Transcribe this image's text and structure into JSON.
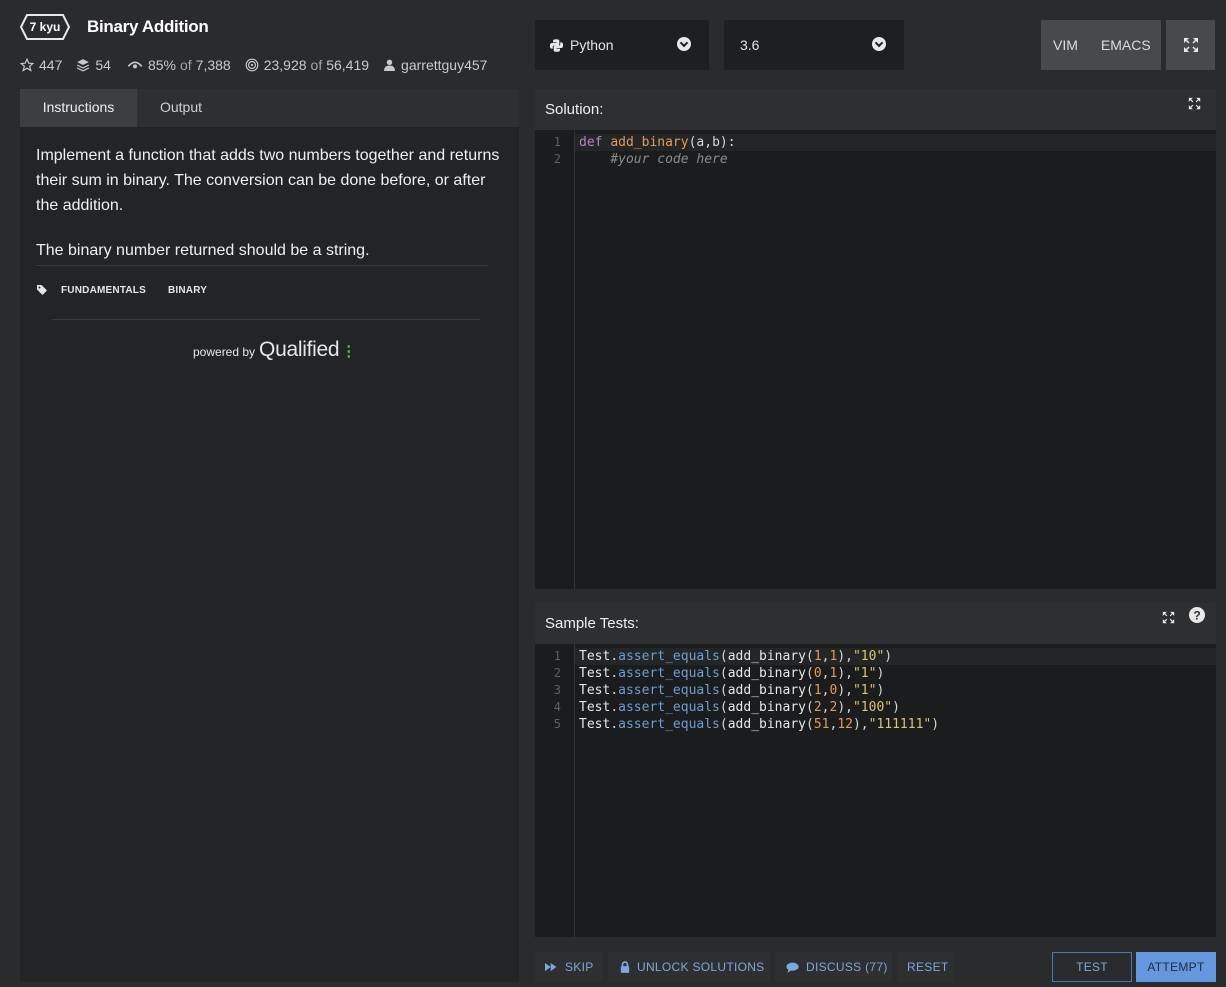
{
  "kata": {
    "rank": "7 kyu",
    "title": "Binary Addition",
    "stars": "447",
    "collections": "54",
    "satisfaction": "85%",
    "satisfaction_of": "of",
    "votes": "7,388",
    "completed": "23,928",
    "completed_of": "of",
    "attempts": "56,419",
    "author": "garrettguy457"
  },
  "toolbar": {
    "language": "Python",
    "version": "3.6",
    "vim_label": "VIM",
    "emacs_label": "EMACS"
  },
  "tabs": [
    {
      "label": "Instructions",
      "active": true
    },
    {
      "label": "Output",
      "active": false
    }
  ],
  "instructions": {
    "paragraphs": [
      "Implement a function that adds two numbers together and returns their sum in binary. The conversion can be done before, or after the addition.",
      "The binary number returned should be a string."
    ],
    "tags": [
      "FUNDAMENTALS",
      "BINARY"
    ],
    "powered_by": "powered by",
    "brand": "Qualified"
  },
  "solution": {
    "title": "Solution:",
    "line_numbers": [
      "1",
      "2"
    ]
  },
  "tests": {
    "title": "Sample Tests:",
    "line_numbers": [
      "1",
      "2",
      "3",
      "4",
      "5"
    ]
  },
  "actions": {
    "skip": "SKIP",
    "unlock": "UNLOCK SOLUTIONS",
    "discuss": "DISCUSS (77)",
    "reset": "RESET",
    "test": "TEST",
    "attempt": "ATTEMPT"
  },
  "colors": {
    "accent": "#6497dd",
    "brand_dots": "#46c35d",
    "background": "#2a2b2d"
  }
}
